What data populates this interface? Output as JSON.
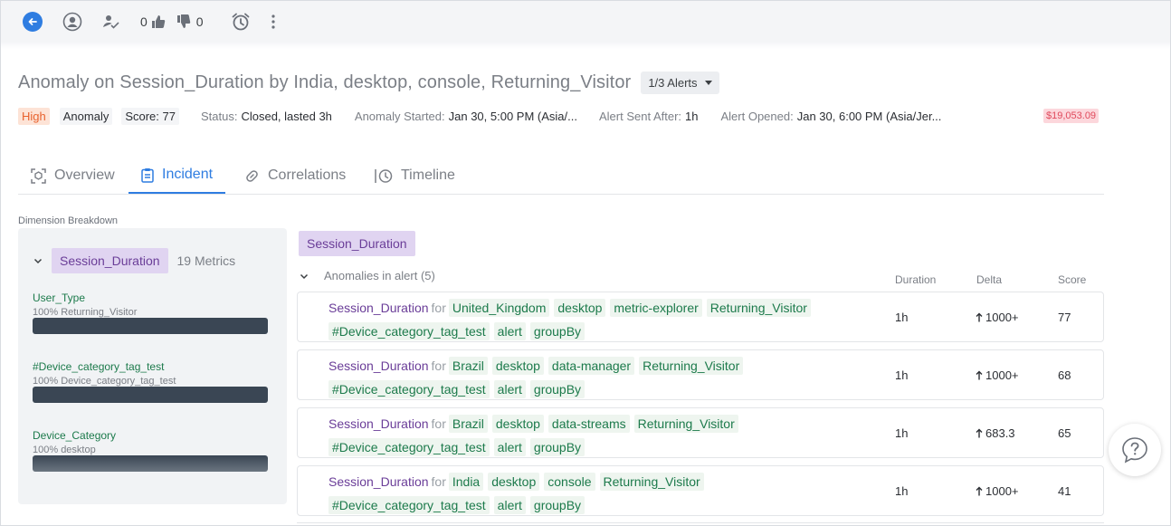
{
  "toolbar": {
    "likes": "0",
    "dislikes": "0"
  },
  "header": {
    "title": "Anomaly on Session_Duration by India, desktop, console, Returning_Visitor",
    "alerts_label": "1/3 Alerts"
  },
  "meta": {
    "severity": "High",
    "type": "Anomaly",
    "score": "Score: 77",
    "status_label": "Status:",
    "status_value": "Closed, lasted 3h",
    "started_label": "Anomaly Started:",
    "started_value": "Jan 30, 5:00 PM (Asia/...",
    "sent_label": "Alert Sent After:",
    "sent_value": "1h",
    "opened_label": "Alert Opened:",
    "opened_value": "Jan 30, 6:00 PM (Asia/Jer...",
    "cost": "$19,053.09"
  },
  "tabs": [
    {
      "label": "Overview"
    },
    {
      "label": "Incident"
    },
    {
      "label": "Correlations"
    },
    {
      "label": "Timeline"
    }
  ],
  "breakdown": {
    "section_label": "Dimension Breakdown",
    "metric": "Session_Duration",
    "count": "19 Metrics",
    "dimensions": [
      {
        "name": "User_Type",
        "sub": "100% Returning_Visitor"
      },
      {
        "name": "#Device_category_tag_test",
        "sub": "100% Device_category_tag_test"
      },
      {
        "name": "Device_Category",
        "sub": "100% desktop"
      }
    ]
  },
  "anomalies": {
    "filter": "Session_Duration",
    "heading": "Anomalies in alert (5)",
    "columns": {
      "duration": "Duration",
      "delta": "Delta",
      "score": "Score"
    },
    "for_word": "for",
    "rows": [
      {
        "metric": "Session_Duration",
        "tags": [
          "United_Kingdom",
          "desktop",
          "metric-explorer",
          "Returning_Visitor",
          "#Device_category_tag_test",
          "alert",
          "groupBy"
        ],
        "duration": "1h",
        "delta": "1000+",
        "score": "77"
      },
      {
        "metric": "Session_Duration",
        "tags": [
          "Brazil",
          "desktop",
          "data-manager",
          "Returning_Visitor",
          "#Device_category_tag_test",
          "alert",
          "groupBy"
        ],
        "duration": "1h",
        "delta": "1000+",
        "score": "68"
      },
      {
        "metric": "Session_Duration",
        "tags": [
          "Brazil",
          "desktop",
          "data-streams",
          "Returning_Visitor",
          "#Device_category_tag_test",
          "alert",
          "groupBy"
        ],
        "duration": "1h",
        "delta": "683.3",
        "score": "65"
      },
      {
        "metric": "Session_Duration",
        "tags": [
          "India",
          "desktop",
          "console",
          "Returning_Visitor",
          "#Device_category_tag_test",
          "alert",
          "groupBy"
        ],
        "duration": "1h",
        "delta": "1000+",
        "score": "41"
      }
    ]
  }
}
